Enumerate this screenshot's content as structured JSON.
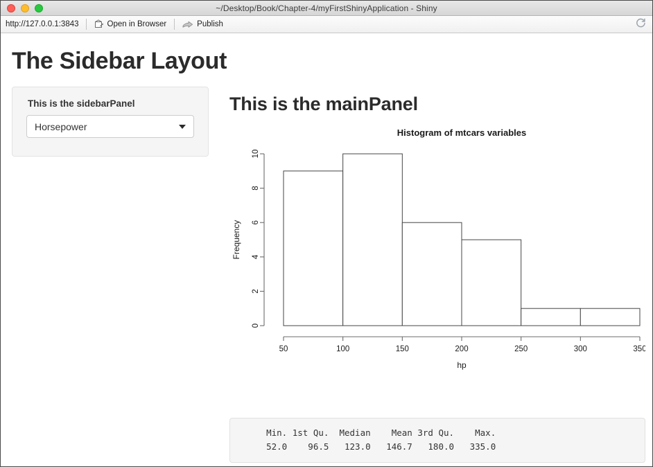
{
  "window": {
    "title": "~/Desktop/Book/Chapter-4/myFirstShinyApplication - Shiny",
    "traffic_lights": [
      "close",
      "minimize",
      "maximize"
    ]
  },
  "toolbar": {
    "url": "http://127.0.0.1:3843",
    "open_in_browser_label": "Open in Browser",
    "publish_label": "Publish",
    "reload_icon": "reload-icon",
    "open_in_browser_icon": "open-in-browser-icon",
    "publish_icon": "publish-arrow-icon"
  },
  "page": {
    "title": "The Sidebar Layout"
  },
  "sidebar": {
    "label": "This is the sidebarPanel",
    "select": {
      "value": "Horsepower",
      "caret_icon": "chevron-down-icon"
    }
  },
  "main": {
    "heading": "This is the mainPanel",
    "summary_header": "    Min. 1st Qu.  Median    Mean 3rd Qu.    Max. ",
    "summary_values": "    52.0    96.5   123.0   146.7   180.0   335.0 "
  },
  "chart_data": {
    "type": "bar",
    "title": "Histogram of mtcars variables",
    "xlabel": "hp",
    "ylabel": "Frequency",
    "bin_edges": [
      50,
      100,
      150,
      200,
      250,
      300,
      350
    ],
    "categories": [
      "50-100",
      "100-150",
      "150-200",
      "200-250",
      "250-300",
      "300-350"
    ],
    "values": [
      9,
      10,
      6,
      5,
      1,
      1
    ],
    "xticks": [
      50,
      100,
      150,
      200,
      250,
      300,
      350
    ],
    "yticks": [
      0,
      2,
      4,
      6,
      8,
      10
    ],
    "xlim": [
      50,
      350
    ],
    "ylim": [
      0,
      10
    ],
    "grid": false,
    "bar_fill": "#ffffff",
    "bar_stroke": "#444444",
    "axis_color": "#6b6b6b"
  }
}
